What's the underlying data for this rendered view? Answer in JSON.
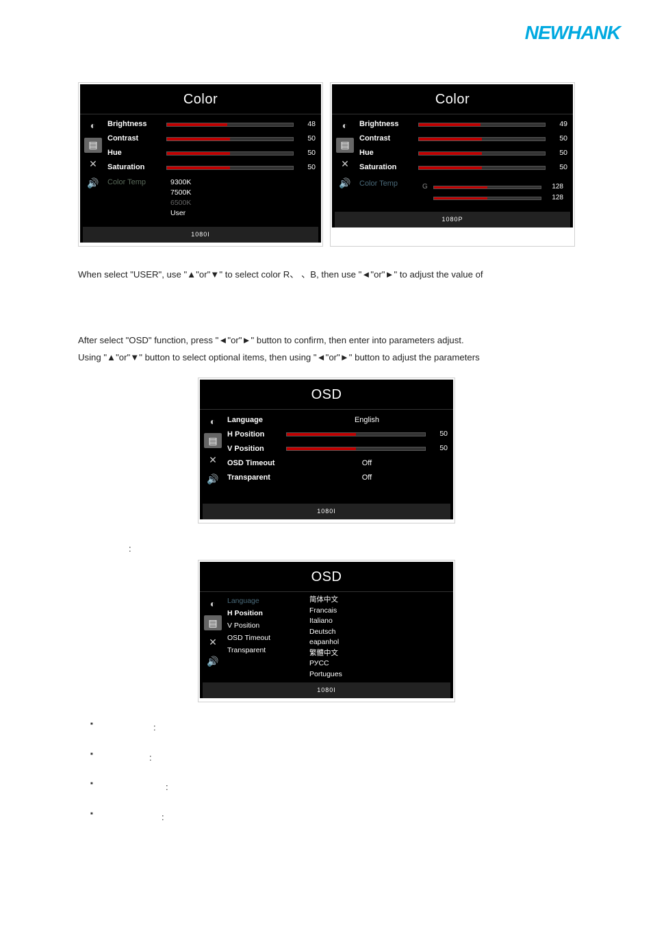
{
  "logo": "NEWHANK",
  "colorPanelLeft": {
    "title": "Color",
    "rows": [
      {
        "label": "Brightness",
        "value": "48",
        "fill": 48
      },
      {
        "label": "Contrast",
        "value": "50",
        "fill": 50
      },
      {
        "label": "Hue",
        "value": "50",
        "fill": 50
      },
      {
        "label": "Saturation",
        "value": "50",
        "fill": 50
      }
    ],
    "colorTempLabel": "Color Temp",
    "tempOptions": [
      "9300K",
      "7500K",
      "6500K",
      "User"
    ],
    "footer": "1080I"
  },
  "colorPanelRight": {
    "title": "Color",
    "rows": [
      {
        "label": "Brightness",
        "value": "49",
        "fill": 49
      },
      {
        "label": "Contrast",
        "value": "50",
        "fill": 50
      },
      {
        "label": "Hue",
        "value": "50",
        "fill": 50
      },
      {
        "label": "Saturation",
        "value": "50",
        "fill": 50
      }
    ],
    "colorTempLabel": "Color Temp",
    "rg": [
      {
        "ch": "G",
        "value": "128",
        "fill": 50
      },
      {
        "ch": "",
        "value": "128",
        "fill": 50
      }
    ],
    "footer": "1080P"
  },
  "text1": "When select \"USER\", use \"▲\"or\"▼\" to select color R、  、B, then use \"◄\"or\"►\" to adjust the value of",
  "text2a": "After select \"OSD\" function, press \"◄\"or\"►\" button to confirm, then enter into parameters adjust.",
  "text2b": "Using \"▲\"or\"▼\" button to select optional items, then using \"◄\"or\"►\" button to adjust the parameters",
  "osdPanel1": {
    "title": "OSD",
    "rows": [
      {
        "label": "Language",
        "type": "text",
        "value": "English"
      },
      {
        "label": "H Position",
        "type": "slider",
        "value": "50",
        "fill": 50
      },
      {
        "label": "V Position",
        "type": "slider",
        "value": "50",
        "fill": 50
      },
      {
        "label": "OSD Timeout",
        "type": "text",
        "value": "Off"
      },
      {
        "label": "Transparent",
        "type": "text",
        "value": "Off"
      }
    ],
    "footer": "1080I"
  },
  "osdLabelLine": ":",
  "osdPanel2": {
    "title": "OSD",
    "highlightLabel": "Language",
    "rows": [
      "H Position",
      "V Position",
      "OSD Timeout",
      "Transparent"
    ],
    "languages": [
      "简体中文",
      "Francais",
      "Italiano",
      "Deutsch",
      "eapanhol",
      "繁體中文",
      "РУСС",
      "Portugues"
    ],
    "langTopDim": "",
    "footer": "1080I"
  },
  "bullets": [
    ":",
    ":",
    ":",
    ":"
  ]
}
